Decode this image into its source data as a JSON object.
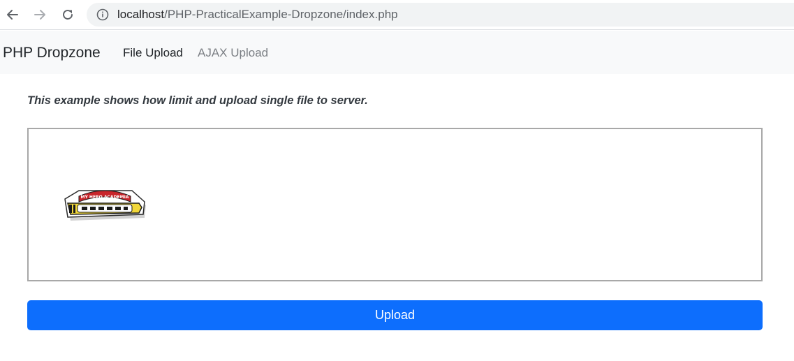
{
  "browser": {
    "url_host": "localhost",
    "url_path": "/PHP-PracticalExample-Dropzone/index.php"
  },
  "navbar": {
    "brand": "PHP Dropzone",
    "links": [
      {
        "label": "File Upload",
        "active": true
      },
      {
        "label": "AJAX Upload",
        "active": false
      }
    ]
  },
  "main": {
    "description": "This example shows how limit and upload single file to server.",
    "dropzone": {
      "thumbnail": {
        "icon": "my-hero-academia-logo-image"
      }
    },
    "upload_button": "Upload"
  },
  "colors": {
    "primary": "#0d6efd",
    "navbar_bg": "#f8f9fa",
    "dropzone_border": "#a8a8a8"
  }
}
